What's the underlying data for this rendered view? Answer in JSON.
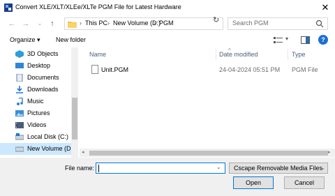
{
  "window": {
    "title": "Convert XLE/XLT/XLEe/XLTe PGM File for Latest Hardware",
    "close_glyph": "✕"
  },
  "nav_buttons": {
    "back": "←",
    "forward": "→",
    "up_dropdown": "⌄",
    "up": "↑"
  },
  "address": {
    "crumbs": [
      "This PC",
      "New Volume (D:)",
      "PGM"
    ],
    "separator": "›",
    "dropdown_glyph": "⌄",
    "refresh_glyph": "↻"
  },
  "search": {
    "placeholder": "Search PGM"
  },
  "toolbar": {
    "organize_label": "Organize ▾",
    "new_folder_label": "New folder",
    "view_dropdown_glyph": "▾",
    "help_glyph": "?"
  },
  "sidebar": {
    "items": [
      {
        "label": "3D Objects",
        "icon": "3d-objects-icon",
        "color": "#2b9fd9"
      },
      {
        "label": "Desktop",
        "icon": "desktop-icon",
        "color": "#2f86d4"
      },
      {
        "label": "Documents",
        "icon": "documents-icon",
        "color": "#6c7ea6"
      },
      {
        "label": "Downloads",
        "icon": "downloads-icon",
        "color": "#1f78d1"
      },
      {
        "label": "Music",
        "icon": "music-icon",
        "color": "#2c7fd2"
      },
      {
        "label": "Pictures",
        "icon": "pictures-icon",
        "color": "#3a8fd8"
      },
      {
        "label": "Videos",
        "icon": "videos-icon",
        "color": "#4b5b7a"
      },
      {
        "label": "Local Disk (C:)",
        "icon": "drive-icon",
        "color": "#7a8aa0"
      },
      {
        "label": "New Volume (D:)",
        "icon": "drive-icon",
        "color": "#7a8aa0",
        "selected": true
      }
    ]
  },
  "file_list": {
    "columns": [
      "Name",
      "Date modified",
      "Type"
    ],
    "sort_glyph": "^",
    "rows": [
      {
        "name": "Unit.PGM",
        "date": "24-04-2024 05:51 PM",
        "type": "PGM File"
      }
    ]
  },
  "scrollbar": {
    "left_glyph": "◂",
    "right_glyph": "▸"
  },
  "bottom": {
    "file_name_label": "File name:",
    "file_name_value": "",
    "file_name_dropdown_glyph": "⌄",
    "filter_label": "Cscape Removable Media Files",
    "filter_dropdown_glyph": "⌄",
    "open_label": "Open",
    "cancel_label": "Cancel"
  },
  "colors": {
    "accent": "#0078d7",
    "selection": "#cce8ff",
    "folder": "#f4c04a",
    "help": "#1d6fd1"
  }
}
